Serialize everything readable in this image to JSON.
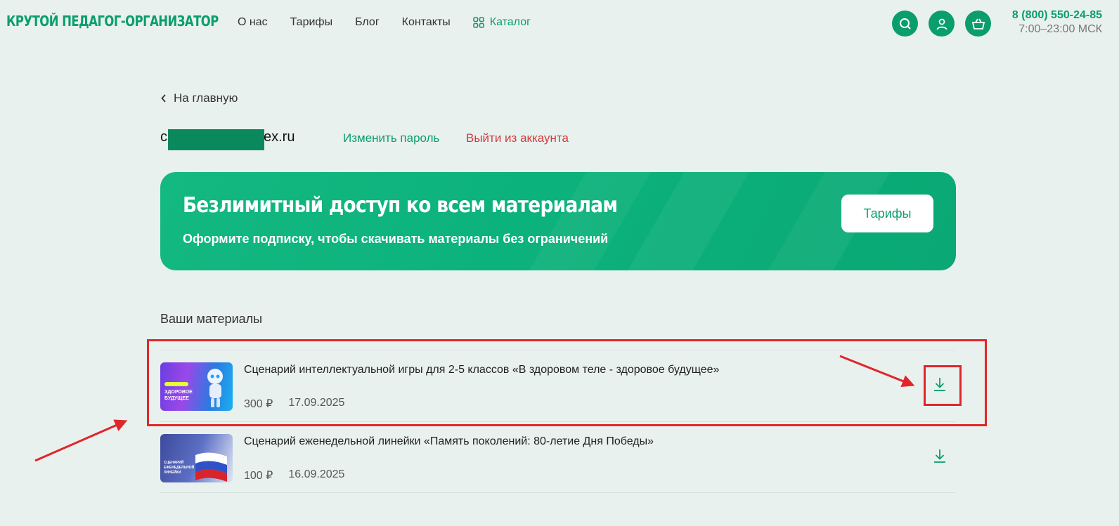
{
  "header": {
    "logo": "КРУТОЙ ПЕДАГОГ-ОРГАНИЗАТОР",
    "nav": [
      "О нас",
      "Тарифы",
      "Блог",
      "Контакты"
    ],
    "catalog_label": "Каталог",
    "phone": "8 (800) 550-24-85",
    "hours": "7:00–23:00 МСК"
  },
  "back_link": "На главную",
  "account": {
    "email_prefix": "c",
    "email_suffix": "ex.ru",
    "change_password": "Изменить пароль",
    "logout": "Выйти из аккаунта"
  },
  "banner": {
    "title": "Безлимитный доступ ко всем материалам",
    "subtitle": "Оформите подписку, чтобы скачивать материалы без ограничений",
    "button": "Тарифы"
  },
  "materials": {
    "title": "Ваши материалы",
    "items": [
      {
        "title": "Сценарий интеллектуальной игры для 2-5 классов «В здоровом теле - здоровое будущее»",
        "price": "300 ₽",
        "date": "17.09.2025",
        "thumb_text": "В ЗДОРОВОМ ТЕЛЕ - ЗДОРОВОЕ БУДУЩЕЕ"
      },
      {
        "title": "Сценарий еженедельной линейки «Память поколений: 80-летие Дня Победы»",
        "price": "100 ₽",
        "date": "16.09.2025",
        "thumb_text": "СЦЕНАРИЙ ЕЖЕНЕДЕЛЬНОЙ ЛИНЕЙКИ"
      }
    ]
  },
  "colors": {
    "brand": "#0a9e6c",
    "logout": "#d13b3b",
    "annotation": "#e0262b",
    "background": "#e9f1ef"
  }
}
